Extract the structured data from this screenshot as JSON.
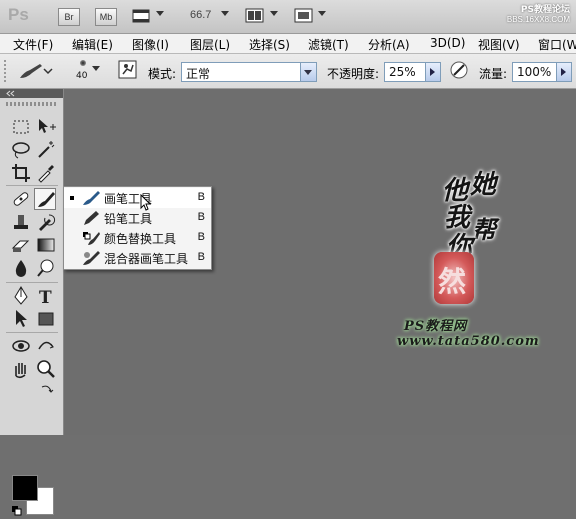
{
  "appbar": {
    "logo": "Ps",
    "br_label": "Br",
    "mb_label": "Mb",
    "zoom": "66.7",
    "watermark_line1": "PS教程论坛",
    "watermark_line2": "BBS.16XX8.COM"
  },
  "menubar": {
    "items": [
      "文件(F)",
      "编辑(E)",
      "图像(I)",
      "图层(L)",
      "选择(S)",
      "滤镜(T)",
      "分析(A)",
      "3D(D)",
      "视图(V)",
      "窗口(W"
    ]
  },
  "options": {
    "brush_size": "40",
    "mode_label": "模式:",
    "mode_value": "正常",
    "opacity_label": "不透明度:",
    "opacity_value": "25%",
    "flow_label": "流量:",
    "flow_value": "100%"
  },
  "flyout": {
    "items": [
      {
        "label": "画笔工具",
        "shortcut": "B",
        "selected": true
      },
      {
        "label": "铅笔工具",
        "shortcut": "B",
        "selected": false
      },
      {
        "label": "颜色替换工具",
        "shortcut": "B",
        "selected": false
      },
      {
        "label": "混合器画笔工具",
        "shortcut": "B",
        "selected": false
      }
    ]
  },
  "canvas_art": {
    "calligraphy": [
      "他",
      "她",
      "我",
      "帮",
      "你"
    ],
    "seal_char": "然",
    "site_line1": "PS教程网",
    "site_line2": "www.tata580.com"
  },
  "colors": {
    "foreground": "#000000",
    "background": "#ffffff",
    "canvas": "#6e6e6e"
  }
}
